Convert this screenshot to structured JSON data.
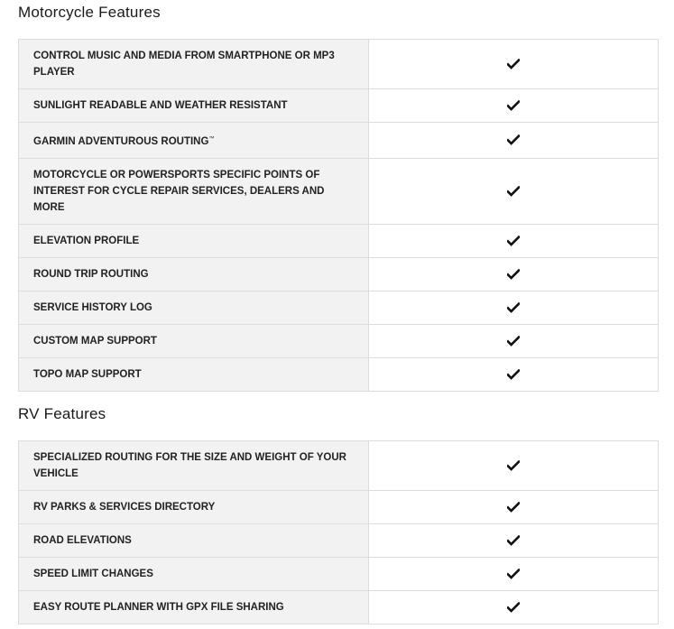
{
  "sections": [
    {
      "title": "Motorcycle Features",
      "rows": [
        {
          "label": "CONTROL MUSIC AND MEDIA FROM SMARTPHONE OR MP3 PLAYER",
          "supported": true
        },
        {
          "label": "SUNLIGHT READABLE AND WEATHER RESISTANT",
          "supported": true
        },
        {
          "label": "GARMIN ADVENTUROUS ROUTING™",
          "supported": true
        },
        {
          "label": "MOTORCYCLE OR POWERSPORTS SPECIFIC POINTS OF INTEREST FOR CYCLE REPAIR SERVICES, DEALERS AND MORE",
          "supported": true
        },
        {
          "label": "ELEVATION PROFILE",
          "supported": true
        },
        {
          "label": "ROUND TRIP ROUTING",
          "supported": true
        },
        {
          "label": "SERVICE HISTORY LOG",
          "supported": true
        },
        {
          "label": "CUSTOM MAP SUPPORT",
          "supported": true
        },
        {
          "label": "TOPO MAP SUPPORT",
          "supported": true
        }
      ]
    },
    {
      "title": "RV Features",
      "rows": [
        {
          "label": "SPECIALIZED ROUTING FOR THE SIZE AND WEIGHT OF YOUR VEHICLE",
          "supported": true
        },
        {
          "label": "RV PARKS & SERVICES DIRECTORY",
          "supported": true
        },
        {
          "label": "ROAD ELEVATIONS",
          "supported": true
        },
        {
          "label": "SPEED LIMIT CHANGES",
          "supported": true
        },
        {
          "label": "EASY ROUTE PLANNER WITH GPX FILE SHARING",
          "supported": true
        }
      ]
    }
  ],
  "icons": {
    "supported": "checkmark-icon"
  },
  "colors": {
    "label_cell_bg": "#f2f2f2",
    "border": "#dcdcdc",
    "text": "#1a1a1a"
  }
}
